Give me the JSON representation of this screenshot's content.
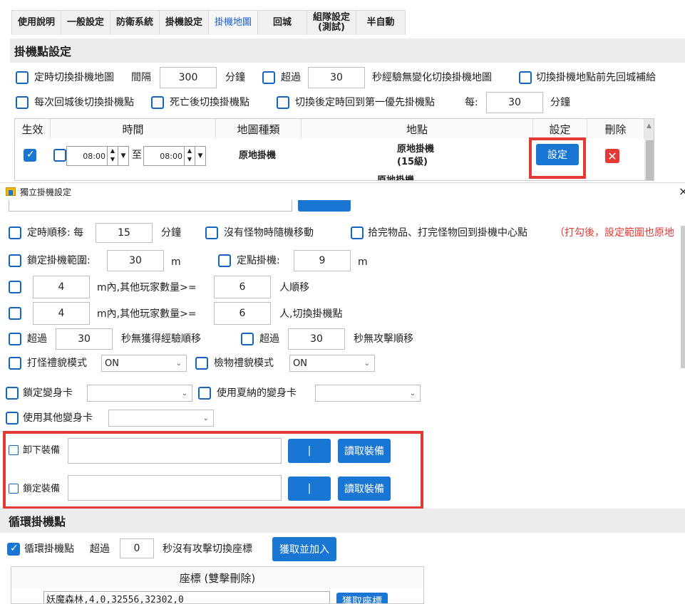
{
  "tabs": [
    "使用說明",
    "一般設定",
    "防衛系統",
    "掛機設定",
    "掛機地圖",
    "回城",
    "組隊設定\n(測試)",
    "半自動"
  ],
  "section_main": {
    "title": "掛機點設定"
  },
  "row1": {
    "timed_switch_label": "定時切換掛機地圖",
    "interval_label": "間隔",
    "interval_value": "300",
    "minutes_label": "分鐘",
    "exceed_label": "超過",
    "exceed_value": "30",
    "no_exp_label": "秒經驗無變化切換掛機地圖",
    "before_switch_label": "切換掛機地點前先回城補給"
  },
  "row2": {
    "after_town_label": "每次回城後切換掛機點",
    "after_death_label": "死亡後切換掛機點",
    "back_first_label": "切換後定時回到第一優先掛機點",
    "every_label": "每:",
    "every_value": "30",
    "minutes_label": "分鐘"
  },
  "table": {
    "headers": [
      "生效",
      "時間",
      "地圖種類",
      "地點",
      "設定",
      "刪除"
    ],
    "row": {
      "time_from": "08:00",
      "to_label": "至",
      "time_to": "08:00",
      "map_type": "原地掛機",
      "place": "原地掛機\n(15級)",
      "set_button": "設定"
    },
    "row2_place": "原地掛機"
  },
  "dialog": {
    "title": "獨立掛機設定",
    "close": "×"
  },
  "d1": {
    "timed_move_label": "定時順移: 每",
    "timed_move_value": "15",
    "minutes_label": "分鐘",
    "no_monster_label": "沒有怪物時隨機移動",
    "pickup_label": "拾完物品、打完怪物回到掛機中心點",
    "note": "（打勾後，設定範圍也原地"
  },
  "d2": {
    "lock_range_label": "鎖定掛機範圍:",
    "lock_range_value": "30",
    "m1": "m",
    "fixed_label": "定點掛機:",
    "fixed_value": "9",
    "m2": "m"
  },
  "d3": {
    "value1": "4",
    "text1": "m內,其他玩家數量>=",
    "value2": "6",
    "text2": "人順移"
  },
  "d4": {
    "value1": "4",
    "text1": "m內,其他玩家數量>=",
    "value2": "6",
    "text2": "人,切換掛機點"
  },
  "d5": {
    "exceed1": "超過",
    "v1": "30",
    "text1": "秒無獲得經驗順移",
    "exceed2": "超過",
    "v2": "30",
    "text2": "秒無攻擊順移"
  },
  "d6": {
    "fight_label": "打怪禮貌模式",
    "fight_value": "ON",
    "pick_label": "檢物禮貌模式",
    "pick_value": "ON"
  },
  "d7": {
    "lock_card_label": "鎖定變身卡",
    "use_summer_label": "使用夏納的變身卡"
  },
  "d8": {
    "use_other_label": "使用其他變身卡"
  },
  "equip": {
    "unequip_label": "卸下裝備",
    "pipe1": "|",
    "read1": "讀取裝備",
    "lock_label": "鎖定裝備",
    "pipe2": "|",
    "read2": "讀取裝備"
  },
  "loop": {
    "title": "循環掛機點",
    "loop_label": "循環掛機點",
    "exceed_label": "超過",
    "exceed_value": "0",
    "no_attack_label": "秒沒有攻擊切換座標",
    "get_add_button": "獲取並加入",
    "coord_header": "座標 (雙擊刪除)",
    "coord_row": "妖魔森林,4,0,32556,32302,0",
    "get_coord_button": "獲取座標"
  },
  "colors": {
    "accent": "#1976d2",
    "highlight": "#e53935"
  }
}
